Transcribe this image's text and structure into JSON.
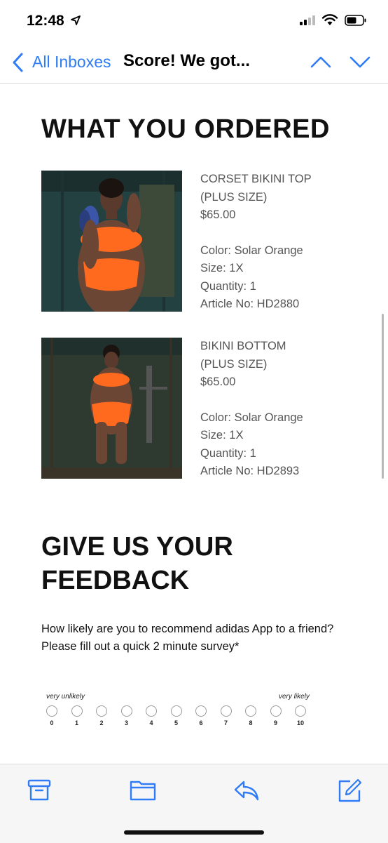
{
  "status_bar": {
    "time": "12:48"
  },
  "nav": {
    "back_label": "All Inboxes",
    "subject": "Score! We got..."
  },
  "email": {
    "ordered_heading": "WHAT YOU ORDERED",
    "products": [
      {
        "name_line1": "CORSET BIKINI TOP",
        "name_line2": "(PLUS SIZE)",
        "price": "$65.00",
        "color": "Color: Solar Orange",
        "size": "Size: 1X",
        "quantity": "Quantity: 1",
        "article": "Article No: HD2880"
      },
      {
        "name_line1": "BIKINI BOTTOM",
        "name_line2": "(PLUS SIZE)",
        "price": "$65.00",
        "color": "Color: Solar Orange",
        "size": "Size: 1X",
        "quantity": "Quantity: 1",
        "article": "Article No: HD2893"
      }
    ],
    "feedback_heading_line1": "GIVE US YOUR",
    "feedback_heading_line2": "FEEDBACK",
    "feedback_text": "How likely are you to recommend adidas App to a friend? Please fill out a quick 2 minute survey*",
    "scale_low_label": "very unlikely",
    "scale_high_label": "very likely",
    "scale_options": [
      "0",
      "1",
      "2",
      "3",
      "4",
      "5",
      "6",
      "7",
      "8",
      "9",
      "10"
    ]
  },
  "toolbar": {
    "icons": [
      "archive-icon",
      "folder-icon",
      "reply-icon",
      "compose-icon"
    ]
  },
  "colors": {
    "accent": "#2f7cf6",
    "product": "#ff6a1f"
  }
}
